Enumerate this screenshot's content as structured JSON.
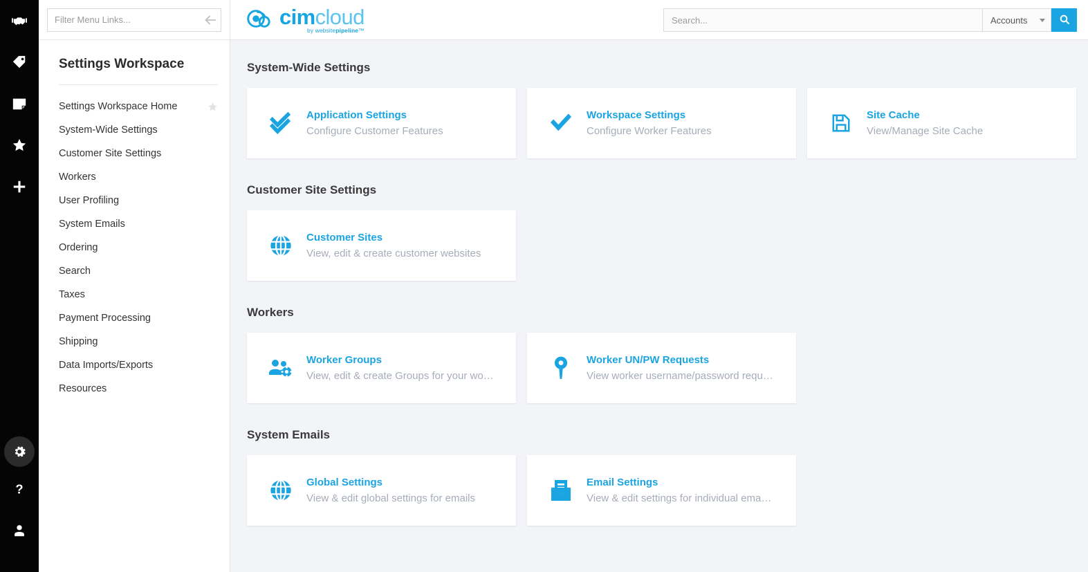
{
  "rail": {
    "top_icons": [
      {
        "name": "handshake-icon"
      },
      {
        "name": "tag-icon"
      },
      {
        "name": "note-icon"
      },
      {
        "name": "star-icon"
      },
      {
        "name": "plus-icon"
      }
    ],
    "bottom_icons": [
      {
        "name": "gear-icon",
        "active": true
      },
      {
        "name": "help-icon"
      },
      {
        "name": "user-icon"
      }
    ]
  },
  "menu": {
    "filter_placeholder": "Filter Menu Links...",
    "workspace_title": "Settings Workspace",
    "items": [
      {
        "label": "Settings Workspace Home",
        "starred": true
      },
      {
        "label": "System-Wide Settings",
        "starred": false
      },
      {
        "label": "Customer Site Settings",
        "starred": false
      },
      {
        "label": "Workers",
        "starred": false
      },
      {
        "label": "User Profiling",
        "starred": false
      },
      {
        "label": "System Emails",
        "starred": false
      },
      {
        "label": "Ordering",
        "starred": false
      },
      {
        "label": "Search",
        "starred": false
      },
      {
        "label": "Taxes",
        "starred": false
      },
      {
        "label": "Payment Processing",
        "starred": false
      },
      {
        "label": "Shipping",
        "starred": false
      },
      {
        "label": "Data Imports/Exports",
        "starred": false
      },
      {
        "label": "Resources",
        "starred": false
      }
    ]
  },
  "header": {
    "collapse_icon": "arrow-left-icon",
    "brand": {
      "primary": "cim",
      "secondary": "cloud",
      "tagline_prefix": "by website",
      "tagline_bold": "pipeline",
      "tagline_suffix": "™"
    },
    "search": {
      "placeholder": "Search...",
      "value": "",
      "scope_selected": "Accounts",
      "button_icon": "search-icon"
    }
  },
  "sections": [
    {
      "title": "System-Wide Settings",
      "cards": [
        {
          "icon": "double-check-icon",
          "title": "Application Settings",
          "desc": "Configure Customer Features"
        },
        {
          "icon": "check-icon",
          "title": "Workspace Settings",
          "desc": "Configure Worker Features"
        },
        {
          "icon": "floppy-disk-icon",
          "title": "Site Cache",
          "desc": "View/Manage Site Cache"
        }
      ]
    },
    {
      "title": "Customer Site Settings",
      "cards": [
        {
          "icon": "globe-icon",
          "title": "Customer Sites",
          "desc": "View, edit & create customer websites"
        }
      ]
    },
    {
      "title": "Workers",
      "cards": [
        {
          "icon": "users-gear-icon",
          "title": "Worker Groups",
          "desc": "View, edit & create Groups for your wo…"
        },
        {
          "icon": "key-icon",
          "title": "Worker UN/PW Requests",
          "desc": "View worker username/password requ…"
        }
      ]
    },
    {
      "title": "System Emails",
      "cards": [
        {
          "icon": "globe-icon",
          "title": "Global Settings",
          "desc": "View & edit global settings for emails"
        },
        {
          "icon": "envelope-doc-icon",
          "title": "Email Settings",
          "desc": "View & edit settings for individual ema…"
        }
      ]
    }
  ],
  "colors": {
    "accent": "#1ba4e2",
    "brand_light": "#5bc4ee",
    "page_bg": "#f2f4f7",
    "rail_bg": "#050505",
    "muted_text": "#a6adb8"
  }
}
